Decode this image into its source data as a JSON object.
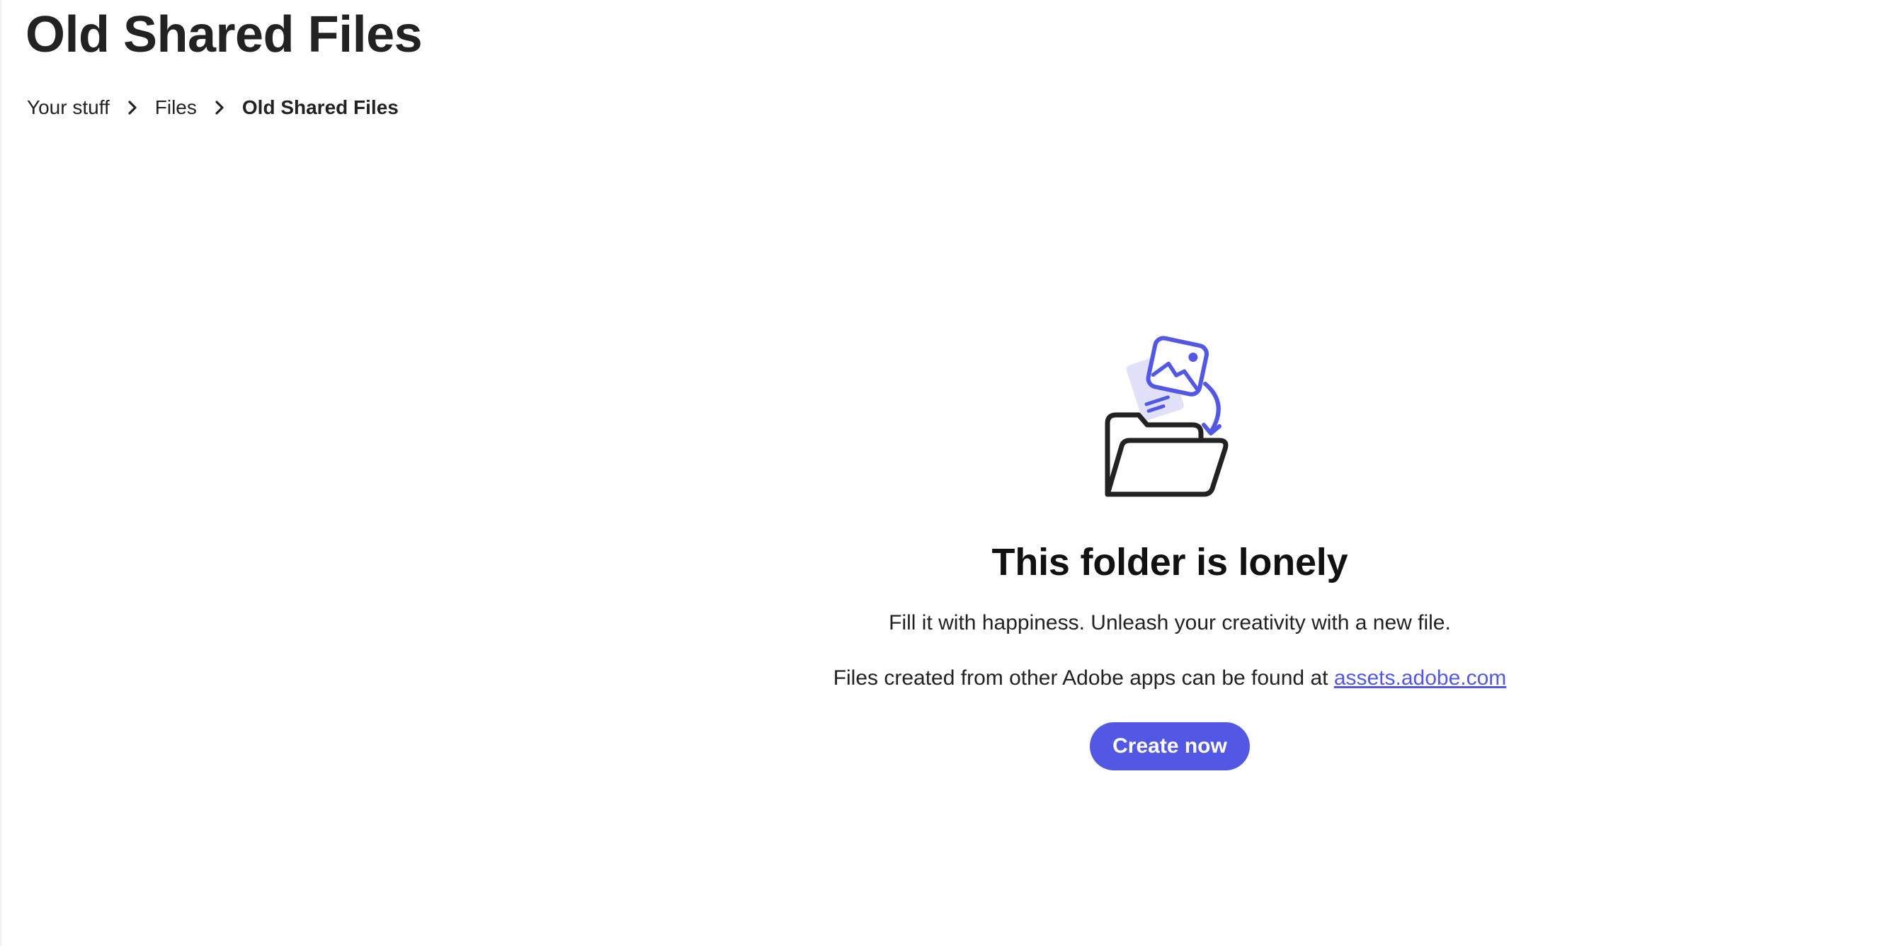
{
  "page": {
    "title": "Old Shared Files"
  },
  "breadcrumb": {
    "items": [
      {
        "label": "Your stuff"
      },
      {
        "label": "Files"
      },
      {
        "label": "Old Shared Files"
      }
    ],
    "separator_icon": "chevron-right-icon"
  },
  "empty_state": {
    "illustration_icon": "folder-with-image-file-icon",
    "title": "This folder is lonely",
    "description": "Fill it with happiness. Unleash your creativity with a new file.",
    "note_prefix": "Files created from other Adobe apps can be found at",
    "note_link": "assets.adobe.com",
    "button_label": "Create now"
  },
  "colors": {
    "accent": "#5258e4",
    "accent_light": "#e0e0f8",
    "text": "#222222"
  }
}
